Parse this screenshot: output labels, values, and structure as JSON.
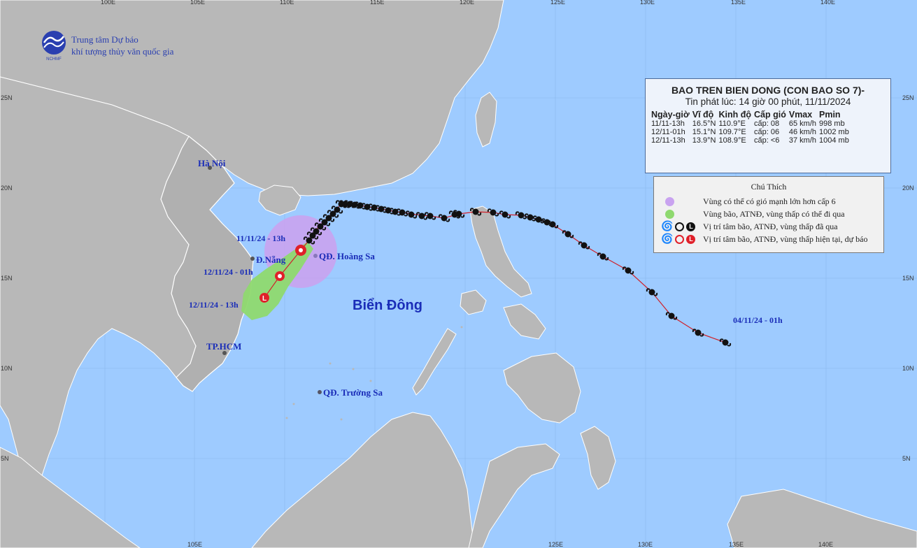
{
  "agency": {
    "line1": "Trung tâm Dự báo",
    "line2": "khí tượng thủy văn quốc gia",
    "logo_text": "NCHMF",
    "logo_icon": "nchmf-globe-logo-icon"
  },
  "info": {
    "title": "BAO TREN BIEN DONG (CON BAO SO 7)-",
    "issued": "Tin phát lúc: 14 giờ 00 phút, 11/11/2024",
    "headers": [
      "Ngày-giờ",
      "Vĩ độ",
      "Kinh độ",
      "Cấp gió",
      "Vmax",
      "Pmin"
    ],
    "rows": [
      [
        "11/11-13h",
        "16.5°N",
        "110.9°E",
        "cấp: 08",
        "65 km/h",
        "998 mb"
      ],
      [
        "12/11-01h",
        "15.1°N",
        "109.7°E",
        "cấp: 06",
        "46 km/h",
        "1002 mb"
      ],
      [
        "12/11-13h",
        "13.9°N",
        "108.9°E",
        "cấp: <6",
        "37 km/h",
        "1004 mb"
      ]
    ]
  },
  "legend": {
    "title": "Chú Thích",
    "items": [
      {
        "text": "Vùng có thể có gió mạnh lớn hơn cấp 6",
        "color": "#c9a3f0"
      },
      {
        "text": "Vùng bão, ATNĐ, vùng thấp có thể đi qua",
        "color": "#8fd96f"
      },
      {
        "text": "Vị trí tâm bão, ATNĐ, vùng thấp đã qua",
        "color": "#111111"
      },
      {
        "text": "Vị trí tâm bão, ATNĐ, vùng thấp hiện tại, dự báo",
        "color": "#e0202a"
      }
    ]
  },
  "places": {
    "hanoi": "Hà Nội",
    "danang": "Đ.Nẵng",
    "hcm": "TP.HCM",
    "hoangsa": "QĐ. Hoàng Sa",
    "truongsa": "QĐ. Trường Sa",
    "biendong": "Biển Đông"
  },
  "track_labels": {
    "l1": "11/11/24 - 13h",
    "l2": "12/11/24 - 01h",
    "l3": "12/11/24 - 13h",
    "start": "04/11/24 - 01h"
  },
  "axes": {
    "top": [
      "100E",
      "105E",
      "110E",
      "115E",
      "120E",
      "125E",
      "130E",
      "135E",
      "140E"
    ],
    "bottom": [
      "105E",
      "125E",
      "130E",
      "135E",
      "140E"
    ],
    "left": [
      "25N",
      "20N",
      "15N",
      "10N",
      "5N"
    ],
    "right": [
      "25N",
      "20N",
      "15N",
      "10N",
      "5N"
    ]
  },
  "colors": {
    "sea": "#9ecbff",
    "land": "#b8b8b8",
    "track": "#d0202a",
    "wind_zone": "#c9a3f0",
    "storm_zone": "#8fd96f"
  }
}
